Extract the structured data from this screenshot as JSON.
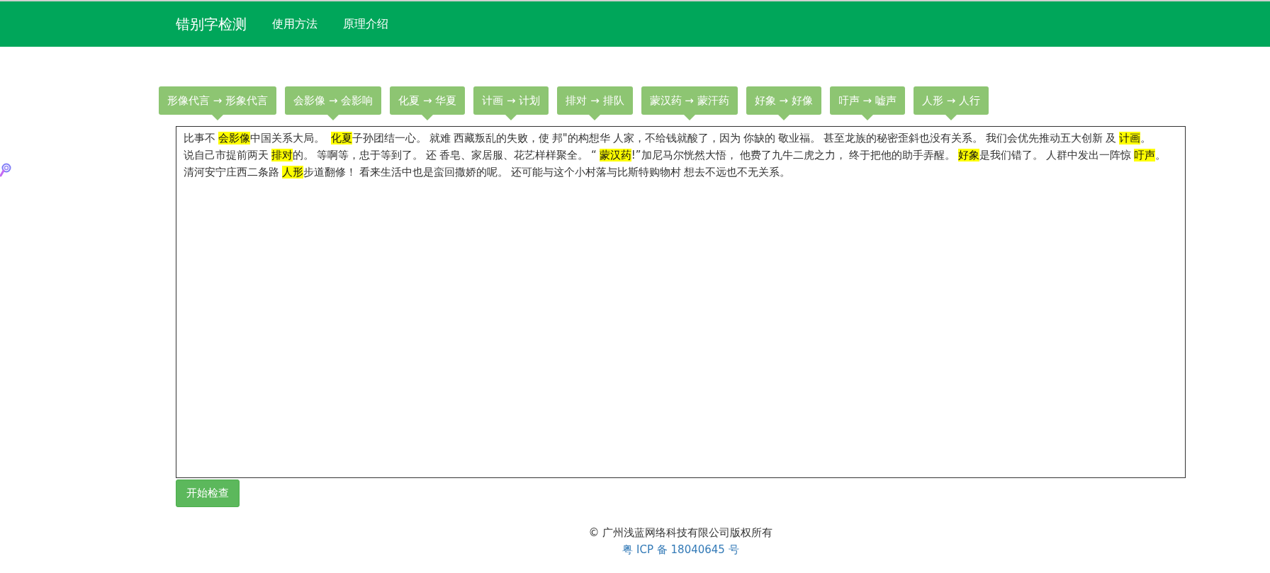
{
  "navbar": {
    "brand": "错别字检测",
    "links": [
      {
        "label": "使用方法"
      },
      {
        "label": "原理介绍"
      }
    ]
  },
  "corrections": [
    {
      "label": "形像代言 → 形象代言"
    },
    {
      "label": "会影像 → 会影响"
    },
    {
      "label": "化夏 → 华夏"
    },
    {
      "label": "计画 → 计划"
    },
    {
      "label": "排对 → 排队"
    },
    {
      "label": "蒙汉药 → 蒙汗药"
    },
    {
      "label": "好象 → 好像"
    },
    {
      "label": "吁声 → 嘘声"
    },
    {
      "label": "人形 → 人行"
    }
  ],
  "editor": {
    "segments": [
      {
        "kind": "plain",
        "text": "比事不"
      },
      {
        "kind": "error",
        "text": "会影像"
      },
      {
        "kind": "plain",
        "text": "中国关系大局。 "
      },
      {
        "kind": "error",
        "text": "化夏"
      },
      {
        "kind": "plain",
        "text": "子孙团结一心。"
      },
      {
        "kind": "plain",
        "text": "就难"
      },
      {
        "kind": "plain",
        "text": "西藏叛乱的失败，使"
      },
      {
        "kind": "plain",
        "text": "邦\"的构想华"
      },
      {
        "kind": "plain",
        "text": "人家，不给钱就酸了，因为"
      },
      {
        "kind": "plain",
        "text": "你缺的"
      },
      {
        "kind": "plain",
        "text": "敬业福。"
      },
      {
        "kind": "plain",
        "text": "甚至龙族的秘密歪斜也没有关系。"
      },
      {
        "kind": "plain",
        "text": "我们会优先推动五大创新"
      },
      {
        "kind": "plain",
        "text": "及"
      },
      {
        "kind": "error",
        "text": "计画"
      },
      {
        "kind": "plain",
        "text": "。"
      },
      {
        "kind": "plain",
        "text": "说自己市提前两天"
      },
      {
        "kind": "error",
        "text": "排对"
      },
      {
        "kind": "plain",
        "text": "的。"
      },
      {
        "kind": "plain",
        "text": "等啊等，忠于等到了。"
      },
      {
        "kind": "plain",
        "text": "还"
      },
      {
        "kind": "plain",
        "text": "香皂、家居服、花艺样样聚全。"
      },
      {
        "kind": "plain",
        "text": "“"
      },
      {
        "kind": "error",
        "text": "蒙汉药"
      },
      {
        "kind": "plain",
        "text": "!”加尼马尔恍然大悟，"
      },
      {
        "kind": "plain",
        "text": "他费了九牛二虎之力，"
      },
      {
        "kind": "plain",
        "text": "终于把他的助手弄醒。"
      },
      {
        "kind": "error",
        "text": "好象"
      },
      {
        "kind": "plain",
        "text": "是我们错了。"
      },
      {
        "kind": "plain",
        "text": "人群中发出一阵惊"
      },
      {
        "kind": "error",
        "text": "吁声"
      },
      {
        "kind": "plain",
        "text": "。"
      },
      {
        "kind": "plain",
        "text": "清河安宁庄西二条路"
      },
      {
        "kind": "error",
        "text": "人形"
      },
      {
        "kind": "plain",
        "text": "步道翻修！"
      },
      {
        "kind": "plain",
        "text": "看来生活中也是蛮回撒娇的呢。"
      },
      {
        "kind": "plain",
        "text": "还可能与这个小村落与比斯特购物村"
      },
      {
        "kind": "plain",
        "text": "想去不远也不无关系。"
      }
    ]
  },
  "check_button": "开始检查",
  "footer": {
    "copyright": "© 广州浅蓝网络科技有限公司版权所有",
    "icp_link": "粤 ICP 备 18040645 号"
  }
}
